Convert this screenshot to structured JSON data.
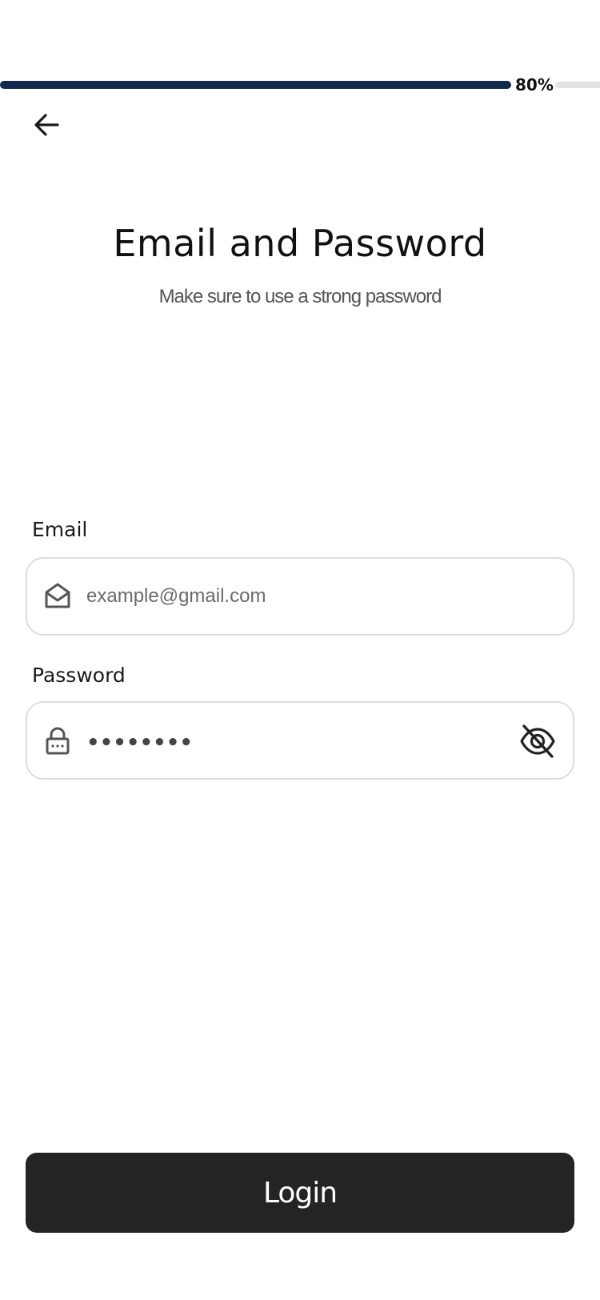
{
  "progress": {
    "value_percent": 80,
    "label": "80%",
    "fill_color": "#13294b",
    "track_color": "#e3e3e3"
  },
  "nav": {
    "back_icon": "arrow-left-icon"
  },
  "header": {
    "title": "Email and Password",
    "subtitle": "Make sure to use a strong password"
  },
  "form": {
    "email": {
      "label": "Email",
      "placeholder": "example@gmail.com",
      "icon": "envelope-icon"
    },
    "password": {
      "label": "Password",
      "masked_value": "••••••••",
      "icon": "lock-icon",
      "toggle_icon": "eye-off-icon"
    }
  },
  "actions": {
    "login_label": "Login",
    "login_bg": "#242424"
  }
}
